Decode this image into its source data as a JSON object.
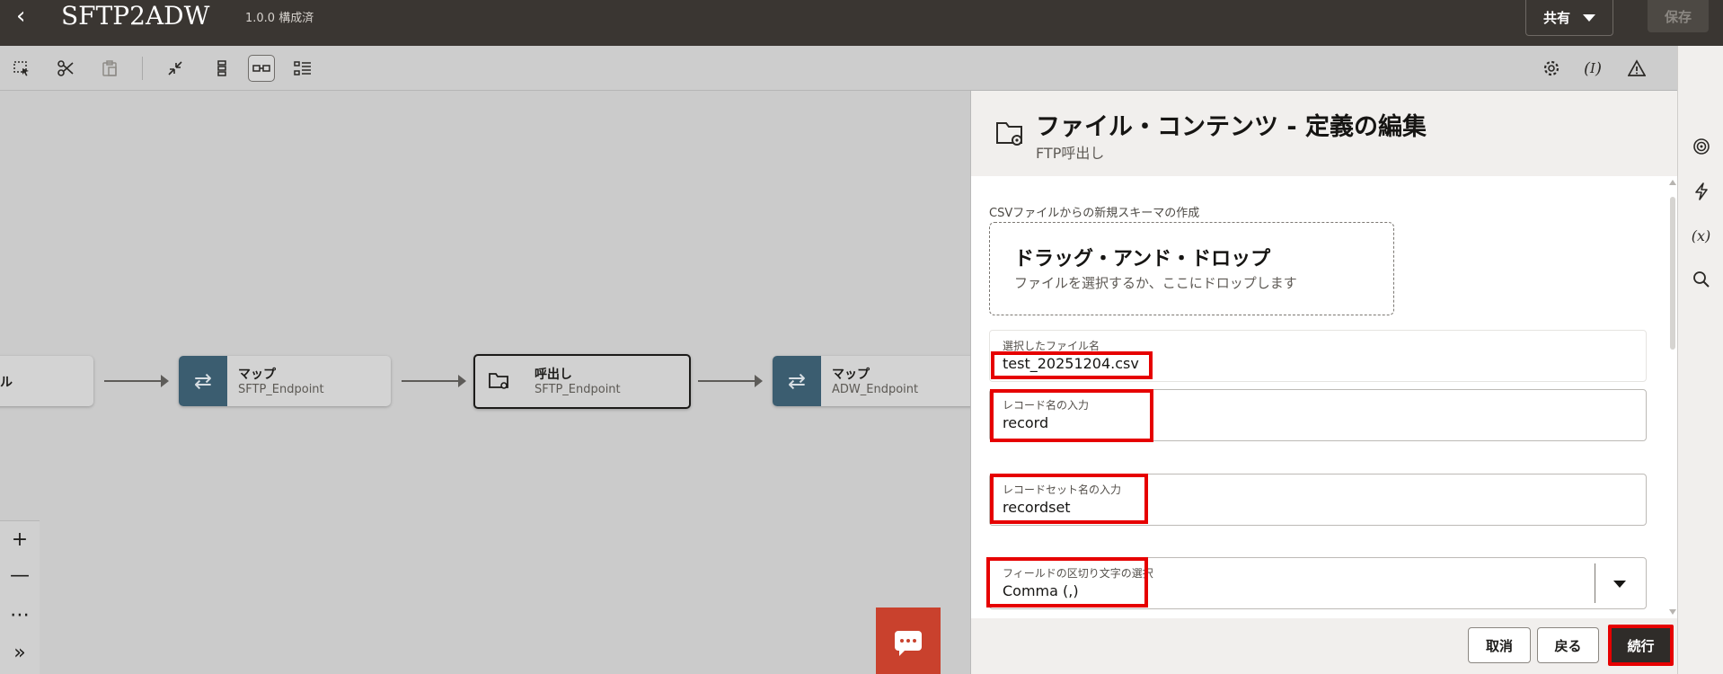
{
  "header": {
    "back_icon": "chevron-left-icon",
    "title": "SFTP2ADW",
    "version": "1.0.0 構成済",
    "share_label": "共有",
    "save_label": "保存"
  },
  "toolbar": {
    "icons": [
      "select-icon",
      "cut-icon",
      "paste-icon",
      "collapse-icon",
      "vertical-layout-icon",
      "horizontal-layout-icon",
      "list-layout-icon"
    ],
    "right_icons": [
      "settings-icon",
      "variable-icon",
      "warning-icon",
      "collapse-up-icon"
    ]
  },
  "canvas": {
    "nodes": [
      {
        "title": "ル",
        "subtitle": ""
      },
      {
        "title": "マップ",
        "subtitle": "SFTP_Endpoint"
      },
      {
        "title": "呼出し",
        "subtitle": "SFTP_Endpoint"
      },
      {
        "title": "マップ",
        "subtitle": "ADW_Endpoint"
      }
    ],
    "zoom": {
      "zoom_in": "+",
      "zoom_out": "—",
      "more": "⋯",
      "expand": "»"
    }
  },
  "drawer": {
    "title": "ファイル・コンテンツ - 定義の編集",
    "subtitle": "FTP呼出し",
    "section_label": "CSVファイルからの新規スキーマの作成",
    "dropzone": {
      "title": "ドラッグ・アンド・ドロップ",
      "subtitle": "ファイルを選択するか、ここにドロップします"
    },
    "fields": {
      "file_name": {
        "label": "選択したファイル名",
        "value": "test_20251204.csv"
      },
      "record_name": {
        "label": "レコード名の入力",
        "value": "record"
      },
      "recordset_name": {
        "label": "レコードセット名の入力",
        "value": "recordset"
      },
      "delimiter": {
        "label": "フィールドの区切り文字の選択",
        "value": "Comma (,)"
      }
    },
    "footer": {
      "cancel": "取消",
      "back": "戻る",
      "continue": "続行"
    }
  },
  "rail": {
    "icons": [
      "target-icon",
      "lightning-icon",
      "function-icon",
      "search-icon"
    ]
  },
  "colors": {
    "header_bg": "#3a3632",
    "node_badge": "#3b5d70",
    "highlight": "#e60000",
    "chat_btn": "#c9412d"
  }
}
